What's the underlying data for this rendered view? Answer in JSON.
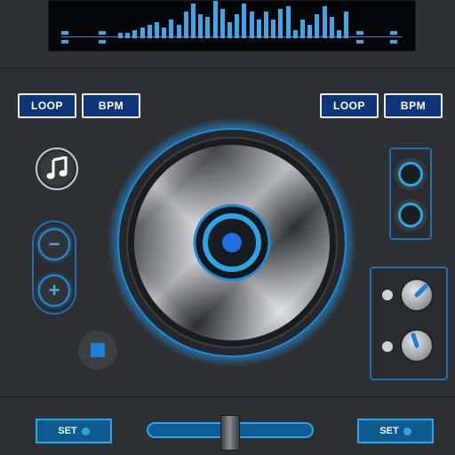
{
  "deck_left": {
    "loop_label": "LOOP",
    "bpm_label": "BPM"
  },
  "deck_right": {
    "loop_label": "LOOP",
    "bpm_label": "BPM"
  },
  "pitch": {
    "minus_label": "−",
    "plus_label": "+"
  },
  "bottom": {
    "set_left_label": "SET",
    "set_right_label": "SET",
    "crossfader_position": 0.5
  },
  "spectrum": {
    "levels": [
      2,
      2,
      3,
      4,
      5,
      6,
      4,
      7,
      5,
      10,
      13,
      9,
      8,
      14,
      11,
      6,
      9,
      13,
      10,
      7,
      10,
      7,
      11,
      12,
      3,
      7,
      5,
      9,
      12,
      8,
      3,
      10
    ]
  },
  "colors": {
    "accent": "#2aa6e8",
    "button_fill": "#10367a",
    "background": "#2f3033"
  },
  "icons": [
    "music-note-icon",
    "stop-icon",
    "minus-icon",
    "plus-icon",
    "led-icon"
  ]
}
